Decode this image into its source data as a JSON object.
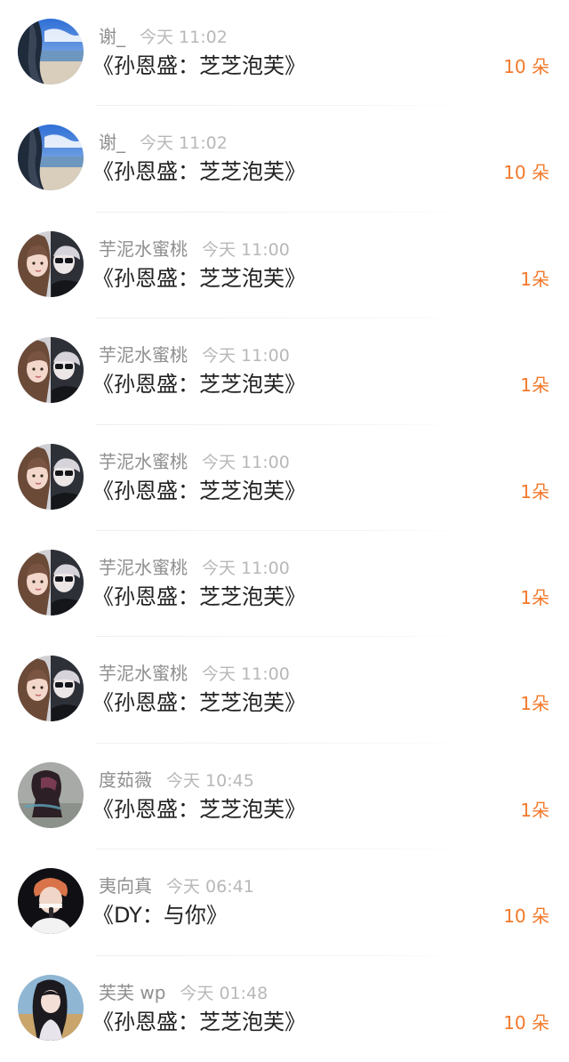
{
  "colors": {
    "accent": "#f2792b",
    "name": "#8f8f8f",
    "time": "#b8b8b8",
    "title": "#222222"
  },
  "gifts": [
    {
      "name": "谢_",
      "time": "今天 11:02",
      "title": "《孙恩盛：芝芝泡芙》",
      "count": "10 朵",
      "avatar": "sea"
    },
    {
      "name": "谢_",
      "time": "今天 11:02",
      "title": "《孙恩盛：芝芝泡芙》",
      "count": "10 朵",
      "avatar": "sea"
    },
    {
      "name": "芋泥水蜜桃",
      "time": "今天 11:00",
      "title": "《孙恩盛：芝芝泡芙》",
      "count": "1朵",
      "avatar": "pair"
    },
    {
      "name": "芋泥水蜜桃",
      "time": "今天 11:00",
      "title": "《孙恩盛：芝芝泡芙》",
      "count": "1朵",
      "avatar": "pair"
    },
    {
      "name": "芋泥水蜜桃",
      "time": "今天 11:00",
      "title": "《孙恩盛：芝芝泡芙》",
      "count": "1朵",
      "avatar": "pair"
    },
    {
      "name": "芋泥水蜜桃",
      "time": "今天 11:00",
      "title": "《孙恩盛：芝芝泡芙》",
      "count": "1朵",
      "avatar": "pair"
    },
    {
      "name": "芋泥水蜜桃",
      "time": "今天 11:00",
      "title": "《孙恩盛：芝芝泡芙》",
      "count": "1朵",
      "avatar": "pair"
    },
    {
      "name": "度茹薇",
      "time": "今天 10:45",
      "title": "《孙恩盛：芝芝泡芙》",
      "count": "1朵",
      "avatar": "gray"
    },
    {
      "name": "夷向真",
      "time": "今天 06:41",
      "title": "《DY：与你》",
      "count": "10 朵",
      "avatar": "dark"
    },
    {
      "name": "芙芙 wp",
      "time": "今天 01:48",
      "title": "《孙恩盛：芝芝泡芙》",
      "count": "10 朵",
      "avatar": "girl"
    }
  ]
}
